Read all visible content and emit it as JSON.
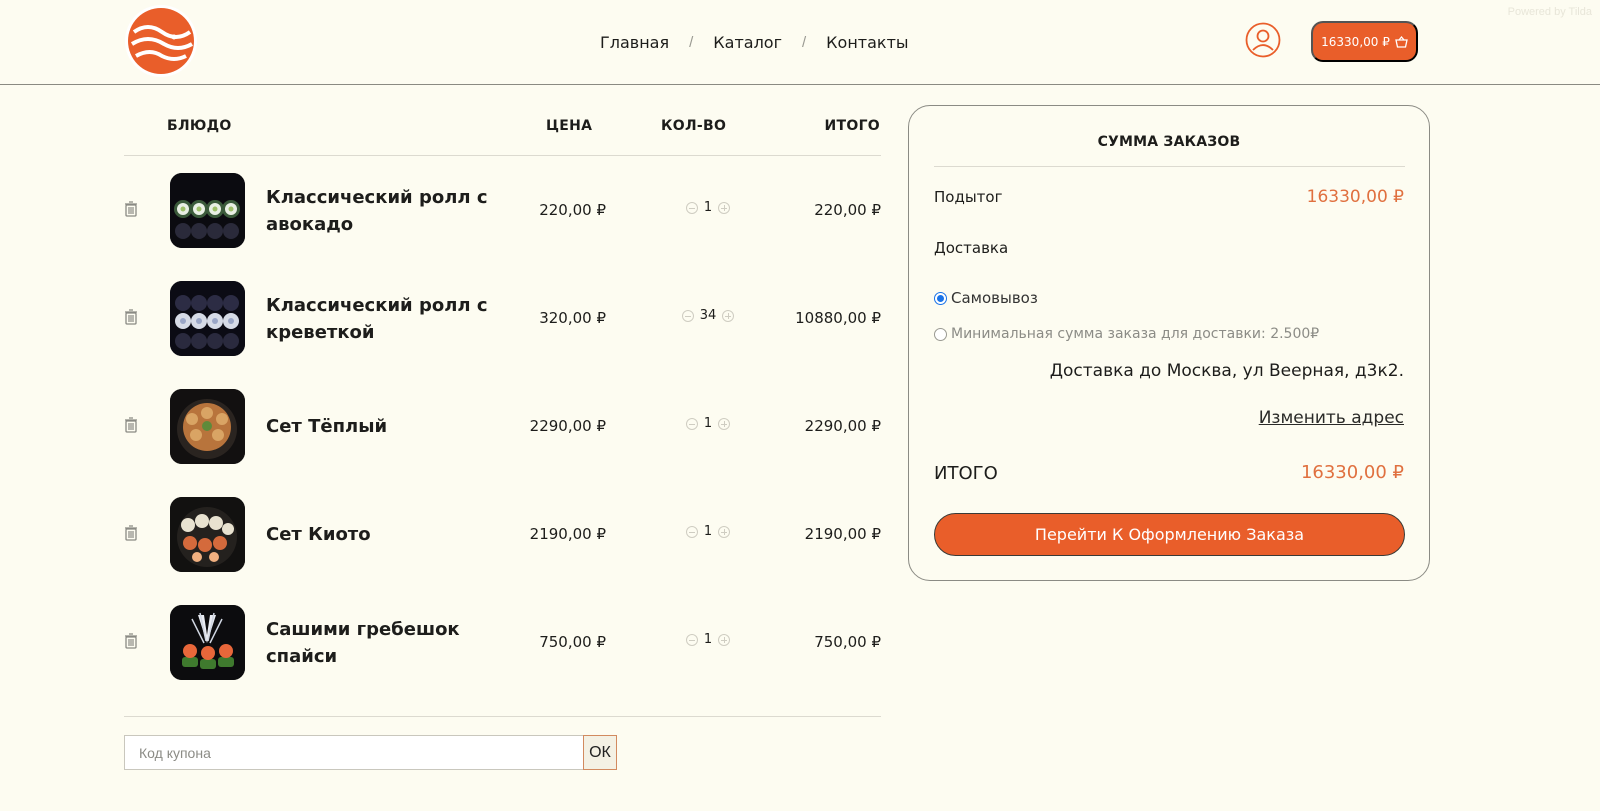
{
  "header": {
    "logo": "fish-logo",
    "nav": [
      {
        "label": "Главная"
      },
      {
        "label": "Каталог"
      },
      {
        "label": "Контакты"
      }
    ],
    "separator": "/",
    "cart_total": "16330,00 ₽",
    "watermark": "Powered by Tilda"
  },
  "table": {
    "headers": {
      "dish": "БЛЮДО",
      "price": "ЦЕНА",
      "qty": "КОЛ-ВО",
      "total": "ИТОГО"
    },
    "rows": [
      {
        "name": "Классический ролл с авокадо",
        "price": "220,00 ₽",
        "qty": "1",
        "total": "220,00 ₽"
      },
      {
        "name": "Классический ролл с креветкой",
        "price": "320,00 ₽",
        "qty": "34",
        "total": "10880,00 ₽"
      },
      {
        "name": "Сет Тёплый",
        "price": "2290,00 ₽",
        "qty": "1",
        "total": "2290,00 ₽"
      },
      {
        "name": "Сет Киото",
        "price": "2190,00 ₽",
        "qty": "1",
        "total": "2190,00 ₽"
      },
      {
        "name": "Сашими гребешок спайси",
        "price": "750,00 ₽",
        "qty": "1",
        "total": "750,00 ₽"
      }
    ]
  },
  "coupon": {
    "placeholder": "Код купона",
    "button": "ОК"
  },
  "summary": {
    "title": "СУММА ЗАКАЗОВ",
    "subtotal_label": "Подытог",
    "subtotal_value": "16330,00 ₽",
    "delivery_label": "Доставка",
    "option_pickup": "Самовывоз",
    "option_delivery": "Минимальная сумма заказа для доставки: 2.500₽",
    "delivery_address": "Доставка до Москва, ул Веерная, д3к2.",
    "change_address": "Изменить адрес",
    "total_label": "ИТОГО",
    "total_value": "16330,00 ₽",
    "checkout_button": "Перейти К Оформлению Заказа"
  },
  "colors": {
    "accent": "#e95e2a",
    "price_accent": "#e0703f",
    "background": "#fdfcf1"
  }
}
